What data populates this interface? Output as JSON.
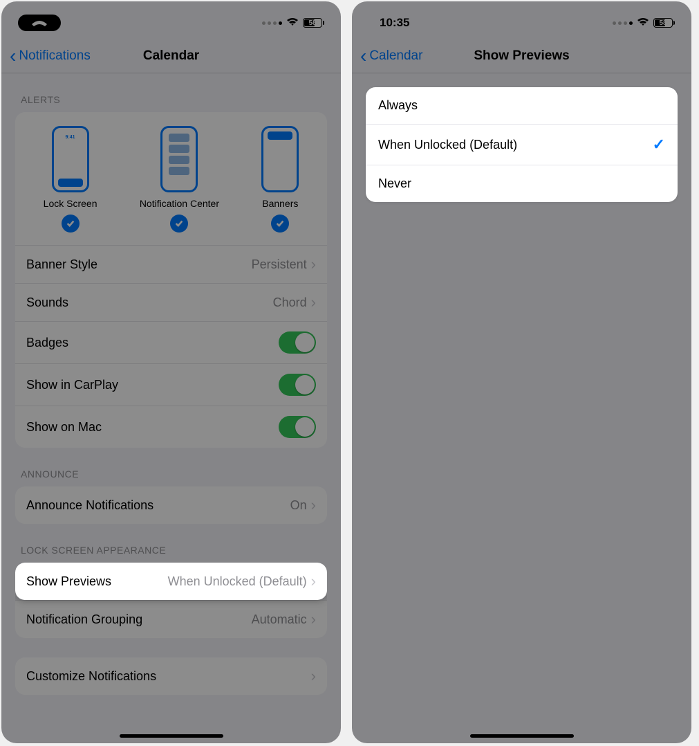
{
  "left": {
    "status": {
      "time": "",
      "battery": "58"
    },
    "nav": {
      "back": "Notifications",
      "title": "Calendar"
    },
    "sections": {
      "alerts_header": "ALERTS",
      "alerts": [
        {
          "label": "Lock Screen",
          "time": "9:41"
        },
        {
          "label": "Notification Center"
        },
        {
          "label": "Banners"
        }
      ],
      "banner_style": {
        "label": "Banner Style",
        "value": "Persistent"
      },
      "sounds": {
        "label": "Sounds",
        "value": "Chord"
      },
      "badges": {
        "label": "Badges"
      },
      "carplay": {
        "label": "Show in CarPlay"
      },
      "mac": {
        "label": "Show on Mac"
      },
      "announce_header": "ANNOUNCE",
      "announce": {
        "label": "Announce Notifications",
        "value": "On"
      },
      "appearance_header": "LOCK SCREEN APPEARANCE",
      "previews": {
        "label": "Show Previews",
        "value": "When Unlocked (Default)"
      },
      "grouping": {
        "label": "Notification Grouping",
        "value": "Automatic"
      },
      "customize": {
        "label": "Customize Notifications"
      }
    }
  },
  "right": {
    "status": {
      "time": "10:35",
      "battery": "58"
    },
    "nav": {
      "back": "Calendar",
      "title": "Show Previews"
    },
    "options": [
      {
        "label": "Always",
        "selected": false
      },
      {
        "label": "When Unlocked (Default)",
        "selected": true
      },
      {
        "label": "Never",
        "selected": false
      }
    ]
  }
}
